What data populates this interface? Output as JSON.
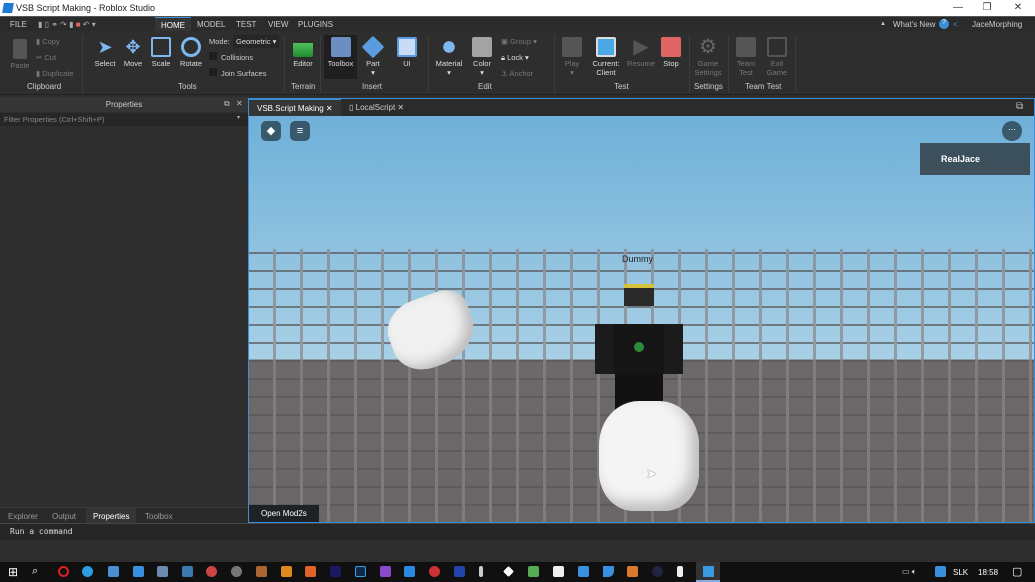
{
  "window": {
    "title": "VSB Script Making - Roblox Studio",
    "minimize": "—",
    "maximize": "❐",
    "close": "✕"
  },
  "menu": {
    "file": "FILE",
    "tabs": [
      "HOME",
      "MODEL",
      "TEST",
      "VIEW",
      "PLUGINS"
    ],
    "whats_new": "What's New",
    "user": "JaceMorphing"
  },
  "ribbon": {
    "clipboard": {
      "paste": "Paste",
      "copy": "Copy",
      "cut": "Cut",
      "duplicate": "Duplicate",
      "group": "Clipboard"
    },
    "tools": {
      "select": "Select",
      "move": "Move",
      "scale": "Scale",
      "rotate": "Rotate",
      "mode_label": "Mode:",
      "mode_value": "Geometric",
      "collisions": "Collisions",
      "join_surfaces": "Join Surfaces",
      "group": "Tools"
    },
    "terrain": {
      "editor": "Editor",
      "group": "Terrain"
    },
    "insert": {
      "toolbox": "Toolbox",
      "part": "Part",
      "ui": "UI",
      "group": "Insert"
    },
    "edit": {
      "material": "Material",
      "color": "Color",
      "group_btn": "Group",
      "lock": "Lock",
      "anchor": "Anchor",
      "group": "Edit"
    },
    "test": {
      "play": "Play",
      "current": "Current:",
      "client": "Client",
      "resume": "Resume",
      "stop": "Stop",
      "group": "Test"
    },
    "settings": {
      "game": "Game",
      "settings": "Settings",
      "group": "Settings"
    },
    "team_test": {
      "team": "Team",
      "test": "Test",
      "exit": "Exit",
      "game": "Game",
      "group": "Team Test"
    }
  },
  "properties": {
    "title": "Properties",
    "filter_placeholder": "Filter Properties (Ctrl+Shift+P)"
  },
  "bottom_tabs": [
    "Explorer",
    "Output",
    "Properties",
    "Toolbox"
  ],
  "viewport": {
    "tabs": [
      "VSB.Script Making",
      "LocalScript"
    ],
    "player": "RealJace",
    "dummy": "Dummy",
    "open_mods": "Open Mod2s"
  },
  "command": {
    "placeholder": "Run a command"
  },
  "taskbar": {
    "lang": "SLK",
    "time": "18:58"
  },
  "colors": {
    "accent": "#3a8fd6",
    "stop": "#e06666"
  }
}
